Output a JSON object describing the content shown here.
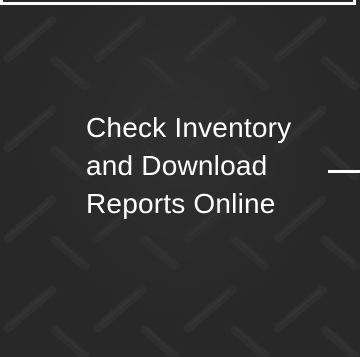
{
  "headline": "Check Inventory and Download Reports Online",
  "colors": {
    "background": "#2c2c2c",
    "text": "#ffffff",
    "frame": "#ffffff"
  },
  "decorations": {
    "background_texture": "diamond-plate-pattern",
    "connector": "horizontal-line"
  }
}
